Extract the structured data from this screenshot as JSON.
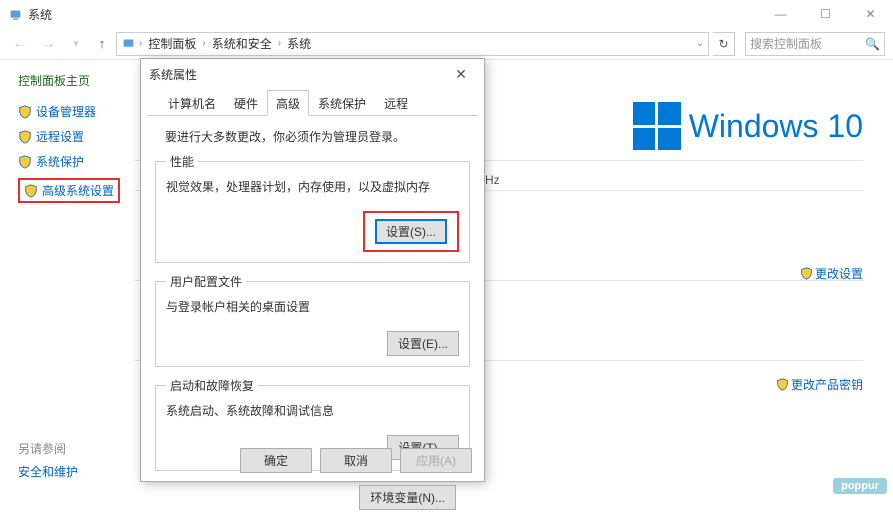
{
  "titlebar": {
    "title": "系统"
  },
  "nav": {
    "crumbs": {
      "root": "控制面板",
      "mid": "系统和安全",
      "leaf": "系统"
    },
    "search_placeholder": "搜索控制面板"
  },
  "sidebar": {
    "header": "控制面板主页",
    "items": [
      {
        "label": "设备管理器"
      },
      {
        "label": "远程设置"
      },
      {
        "label": "系统保护"
      },
      {
        "label": "高级系统设置"
      }
    ]
  },
  "content": {
    "win10_text": "Windows 10",
    "hz_fragment": "Hz",
    "change_settings": "更改设置",
    "change_product_key": "更改产品密钥"
  },
  "seealso": {
    "header": "另请参阅",
    "link": "安全和维护"
  },
  "dialog": {
    "title": "系统属性",
    "tabs": {
      "computer_name": "计算机名",
      "hardware": "硬件",
      "advanced": "高级",
      "system_protection": "系统保护",
      "remote": "远程"
    },
    "note": "要进行大多数更改，你必须作为管理员登录。",
    "perf": {
      "legend": "性能",
      "desc": "视觉效果，处理器计划，内存使用，以及虚拟内存",
      "btn": "设置(S)..."
    },
    "profiles": {
      "legend": "用户配置文件",
      "desc": "与登录帐户相关的桌面设置",
      "btn": "设置(E)..."
    },
    "startup": {
      "legend": "启动和故障恢复",
      "desc": "系统启动、系统故障和调试信息",
      "btn": "设置(T)..."
    },
    "env_btn": "环境变量(N)...",
    "footer": {
      "ok": "确定",
      "cancel": "取消",
      "apply": "应用(A)"
    }
  },
  "watermark": "poppur"
}
